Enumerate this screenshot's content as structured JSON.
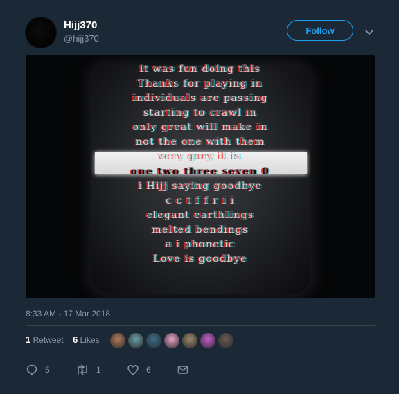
{
  "user": {
    "name": "Hijj370",
    "handle": "@hijj370"
  },
  "follow_label": "Follow",
  "media": {
    "lines": [
      "it was fun doing this",
      "Thanks for playing in",
      "individuals are passing",
      "starting to crawl in",
      "only great will make in",
      "not the one with them",
      "very gory it is",
      "one two three seven 0",
      "i Hijj saying goodbye",
      "c c t f f r i i",
      "elegant earthlings",
      "melted bendings",
      "a i phonetic",
      "Love is goodbye"
    ]
  },
  "timestamp": "8:33 AM - 17 Mar 2018",
  "stats": {
    "retweets": "1",
    "retweets_label": "Retweet",
    "likes": "6",
    "likes_label": "Likes"
  },
  "likers": [
    {
      "name": "liker-1",
      "color": "#b07a5a"
    },
    {
      "name": "liker-2",
      "color": "#6a9fa8"
    },
    {
      "name": "liker-3",
      "color": "#3a6e8a"
    },
    {
      "name": "liker-4",
      "color": "#e8a6c8"
    },
    {
      "name": "liker-5",
      "color": "#9a8a6a"
    },
    {
      "name": "liker-6",
      "color": "#c45fd0"
    },
    {
      "name": "liker-7",
      "color": "#6a5a55"
    }
  ],
  "actions": {
    "replies": "5",
    "retweets": "1",
    "likes": "6"
  },
  "colors": {
    "background": "#1b2836",
    "accent": "#1da1f2",
    "muted": "#8899a6",
    "divider": "#38444d"
  },
  "icons": [
    "reply-icon",
    "retweet-icon",
    "like-icon",
    "message-icon",
    "chevron-down-icon"
  ]
}
